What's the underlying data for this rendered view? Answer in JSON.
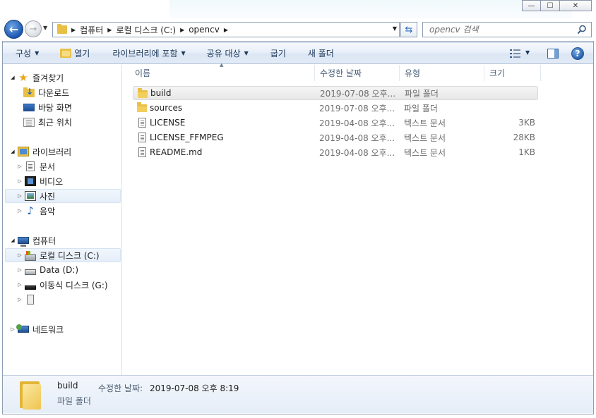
{
  "window": {
    "minimize_glyph": "—",
    "maximize_glyph": "☐",
    "close_glyph": "✕"
  },
  "address_bar": {
    "crumbs": [
      "컴퓨터",
      "로컬 디스크 (C:)",
      "opencv"
    ]
  },
  "search": {
    "placeholder": "opencv 검색"
  },
  "toolbar": {
    "organize": "구성",
    "open": "열기",
    "include_library": "라이브러리에 포함",
    "share": "공유 대상",
    "burn": "굽기",
    "new_folder": "새 폴더",
    "help": "?"
  },
  "nav": {
    "favorites": "즐겨찾기",
    "downloads": "다운로드",
    "desktop": "바탕 화면",
    "recent": "최근 위치",
    "libraries": "라이브러리",
    "documents": "문서",
    "videos": "비디오",
    "pictures": "사진",
    "music": "음악",
    "computer": "컴퓨터",
    "drive_c": "로컬 디스크 (C:)",
    "drive_d": "Data (D:)",
    "drive_g": "이동식 디스크 (G:)",
    "network": "네트워크"
  },
  "columns": {
    "name": "이름",
    "date": "수정한 날짜",
    "type": "유형",
    "size": "크기"
  },
  "files": [
    {
      "name": "build",
      "date": "2019-07-08 오후...",
      "type": "파일 폴더",
      "size": "",
      "kind": "folder"
    },
    {
      "name": "sources",
      "date": "2019-07-08 오후...",
      "type": "파일 폴더",
      "size": "",
      "kind": "folder"
    },
    {
      "name": "LICENSE",
      "date": "2019-04-08 오후...",
      "type": "텍스트 문서",
      "size": "3KB",
      "kind": "text"
    },
    {
      "name": "LICENSE_FFMPEG",
      "date": "2019-04-08 오후...",
      "type": "텍스트 문서",
      "size": "28KB",
      "kind": "text"
    },
    {
      "name": "README.md",
      "date": "2019-04-08 오후...",
      "type": "텍스트 문서",
      "size": "1KB",
      "kind": "text"
    }
  ],
  "details": {
    "name": "build",
    "date_label": "수정한 날짜:",
    "date_value": "2019-07-08 오후 8:19",
    "type": "파일 폴더"
  },
  "colors": {
    "accent": "#1e395b",
    "folder": "#e8c046"
  }
}
